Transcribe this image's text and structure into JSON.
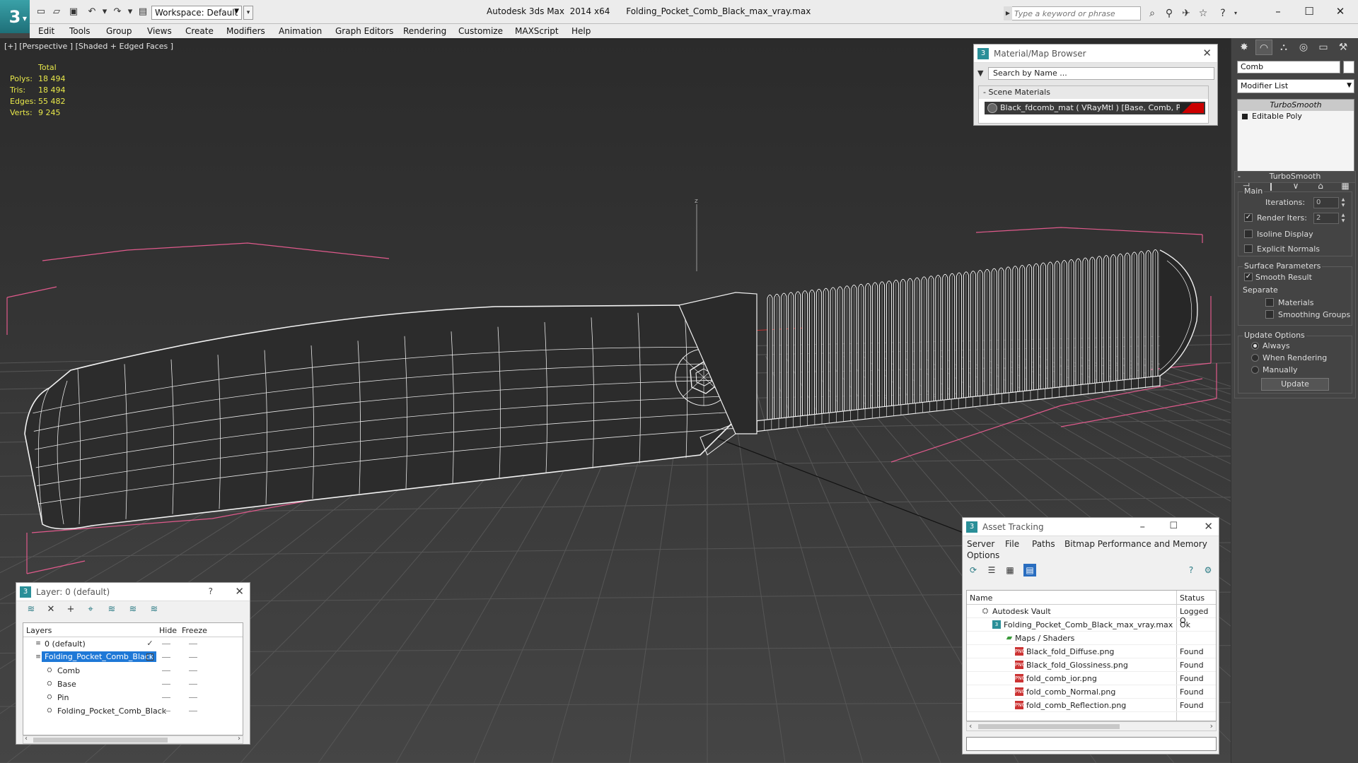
{
  "titlebar": {
    "workspace": "Workspace: Default",
    "title": "Autodesk 3ds Max  2014 x64      Folding_Pocket_Comb_Black_max_vray.max",
    "search_placeholder": "Type a keyword or phrase",
    "controls": {
      "minimize": "–",
      "maximize": "☐",
      "close": "✕"
    }
  },
  "menubar": [
    "Edit",
    "Tools",
    "Group",
    "Views",
    "Create",
    "Modifiers",
    "Animation",
    "Graph Editors",
    "Rendering",
    "Customize",
    "MAXScript",
    "Help"
  ],
  "viewport": {
    "label": "[+] [Perspective ] [Shaded + Edged Faces ]",
    "stats": {
      "header": "Total",
      "rows": [
        {
          "k": "Polys:",
          "v": "18 494"
        },
        {
          "k": "Tris:",
          "v": "18 494"
        },
        {
          "k": "Edges:",
          "v": "55 482"
        },
        {
          "k": "Verts:",
          "v": "9 245"
        }
      ]
    },
    "axis_z": "z",
    "colors": {
      "wire": "#ffffff",
      "bbox": "#e05a8c",
      "grid": "#5a5a5a"
    }
  },
  "material_browser": {
    "title": "Material/Map Browser",
    "search": "Search by Name ...",
    "section": "Scene Materials",
    "item": "Black_fdcomb_mat  ( VRayMtl )  [Base, Comb, Pin]"
  },
  "command_panel": {
    "object_name": "Comb",
    "modifier_list": "Modifier List",
    "stack": [
      "TurboSmooth",
      "Editable Poly"
    ],
    "turbosmooth": {
      "title": "TurboSmooth",
      "main": "Main",
      "iterations_label": "Iterations:",
      "iterations": "0",
      "render_iters_label": "Render Iters:",
      "render_iters": "2",
      "isoline": "Isoline Display",
      "explicit": "Explicit Normals",
      "surface": "Surface Parameters",
      "smooth_result": "Smooth Result",
      "separate": "Separate",
      "materials": "Materials",
      "smoothing_groups": "Smoothing Groups",
      "update_options": "Update Options",
      "always": "Always",
      "when_rendering": "When Rendering",
      "manually": "Manually",
      "update": "Update"
    }
  },
  "layer_panel": {
    "title": "Layer: 0 (default)",
    "help": "?",
    "close": "✕",
    "headers": {
      "layers": "Layers",
      "hide": "Hide",
      "freeze": "Freeze"
    },
    "rows": [
      {
        "name": "0 (default)",
        "indent": 0
      },
      {
        "name": "Folding_Pocket_Comb_Black",
        "indent": 0
      },
      {
        "name": "Comb",
        "indent": 1
      },
      {
        "name": "Base",
        "indent": 1
      },
      {
        "name": "Pin",
        "indent": 1
      },
      {
        "name": "Folding_Pocket_Comb_Black",
        "indent": 1
      }
    ]
  },
  "asset_tracking": {
    "title": "Asset Tracking",
    "menu": [
      "Server",
      "File",
      "Paths",
      "Bitmap Performance and Memory",
      "Options"
    ],
    "headers": {
      "name": "Name",
      "status": "Status"
    },
    "rows": [
      {
        "name": "Autodesk Vault",
        "status": "Logged O",
        "indent": 1
      },
      {
        "name": "Folding_Pocket_Comb_Black_max_vray.max",
        "status": "Ok",
        "indent": 2
      },
      {
        "name": "Maps / Shaders",
        "status": "",
        "indent": 3
      },
      {
        "name": "Black_fold_Diffuse.png",
        "status": "Found",
        "indent": 4
      },
      {
        "name": "Black_fold_Glossiness.png",
        "status": "Found",
        "indent": 4
      },
      {
        "name": "fold_comb_ior.png",
        "status": "Found",
        "indent": 4
      },
      {
        "name": "fold_comb_Normal.png",
        "status": "Found",
        "indent": 4
      },
      {
        "name": "fold_comb_Reflection.png",
        "status": "Found",
        "indent": 4
      }
    ]
  }
}
